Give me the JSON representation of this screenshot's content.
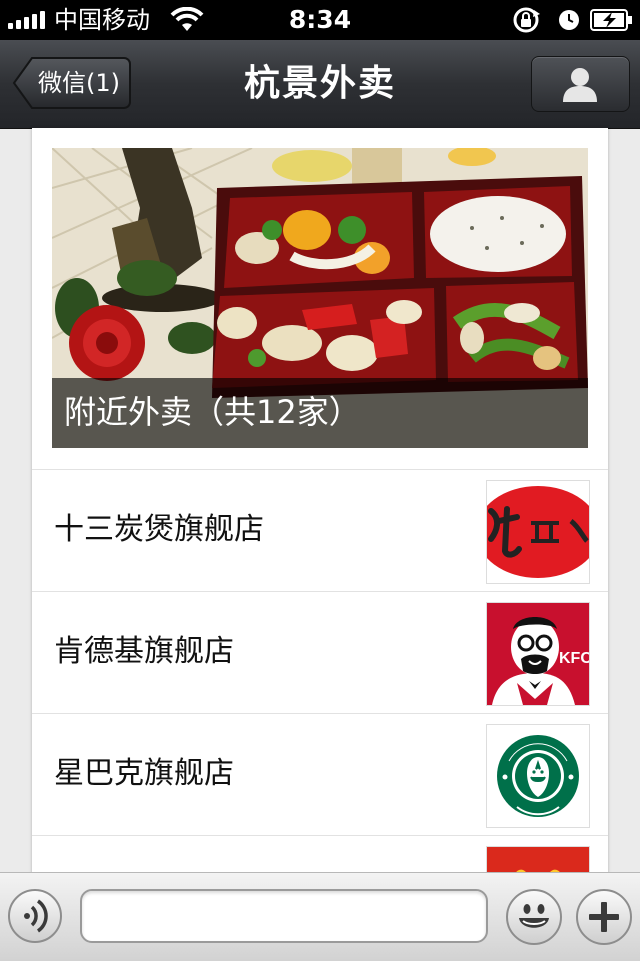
{
  "status_bar": {
    "carrier": "中国移动",
    "time": "8:34",
    "icons": [
      "signal-bars-icon",
      "wifi-icon",
      "rotation-lock-icon",
      "alarm-icon",
      "battery-charging-icon"
    ]
  },
  "nav": {
    "back_label": "微信(1)",
    "title": "杭景外卖",
    "right_icon": "person-icon"
  },
  "hero": {
    "caption": "附近外卖（共12家）",
    "image": "bento-box-photo"
  },
  "stores": [
    {
      "name": "十三炭煲旗舰店",
      "logo": "lao-xi-red-logo"
    },
    {
      "name": "肯德基旗舰店",
      "logo": "kfc-logo"
    },
    {
      "name": "星巴克旗舰店",
      "logo": "starbucks-logo"
    },
    {
      "name": "",
      "logo": "mcdonalds-logo"
    }
  ],
  "bottom_bar": {
    "input_value": "",
    "icons": [
      "voice-icon",
      "emoji-icon",
      "plus-icon"
    ]
  },
  "colors": {
    "nav_bg": "#2e3034",
    "status_bg": "#000000",
    "kfc_red": "#c8102e",
    "starbucks_green": "#00704a",
    "mcd_yellow": "#ffc72c"
  }
}
